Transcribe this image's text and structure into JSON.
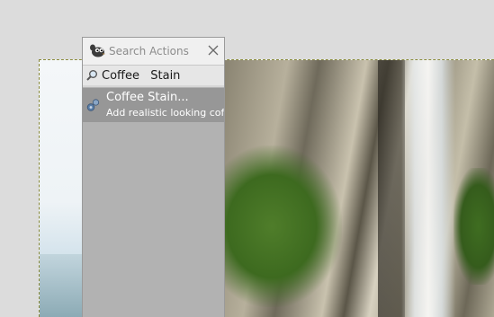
{
  "window": {
    "title": "Search Actions"
  },
  "search": {
    "value": "Coffee  Stain",
    "placeholder": ""
  },
  "results": [
    {
      "title": "Coffee Stain...",
      "description": "Add realistic looking coffee stains to the image"
    }
  ],
  "icons": {
    "app": "gimp-wilber-icon",
    "close": "close-icon",
    "search": "magnifier-icon",
    "result": "filter-icon"
  },
  "colors": {
    "popup_bg": "#b2b2b2",
    "selected_row": "#979797",
    "canvas_bg": "#dcdcdc"
  }
}
